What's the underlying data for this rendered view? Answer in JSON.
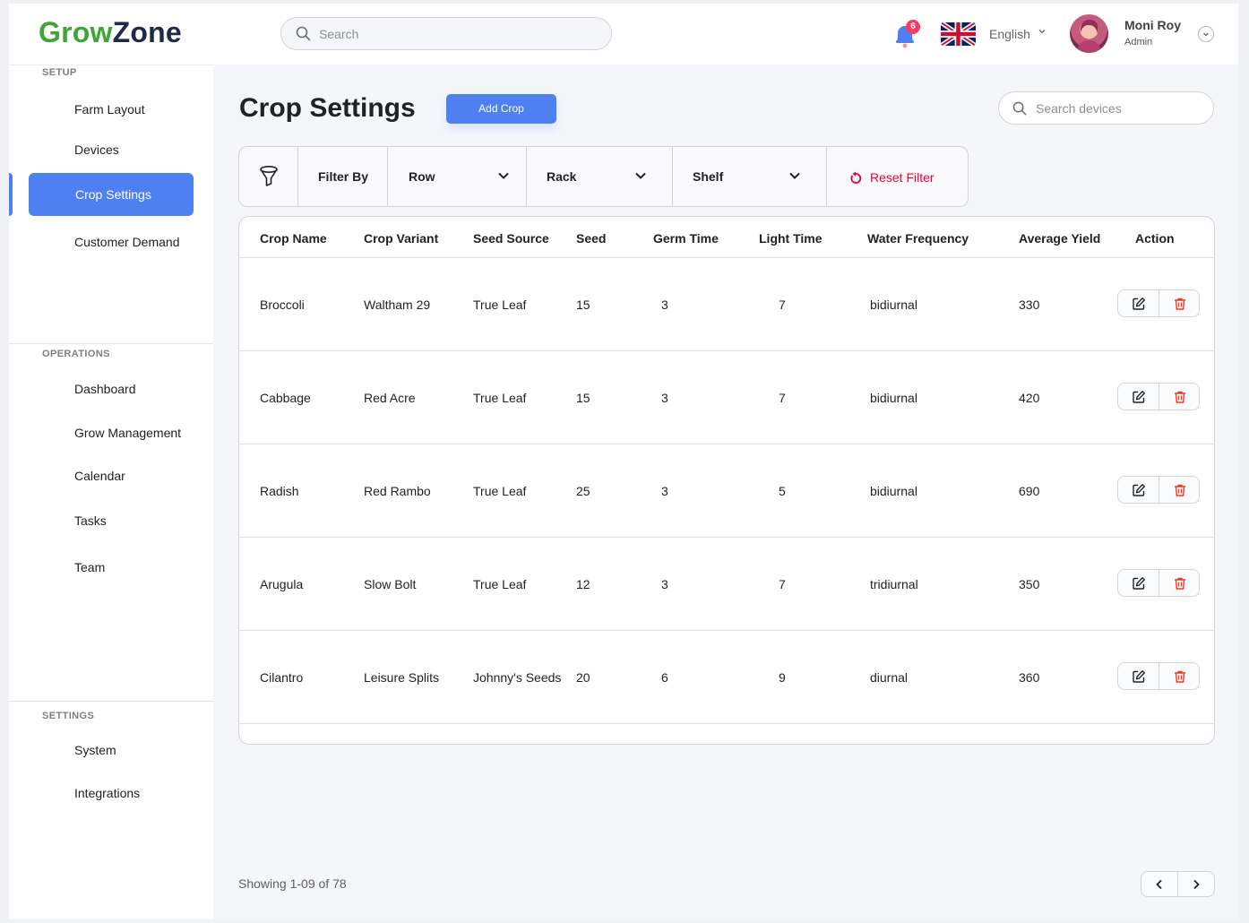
{
  "app": {
    "logo_part1": "Grow",
    "logo_part2": "Zone",
    "search_placeholder": "Search",
    "notification_count": "6",
    "language": "English",
    "user_name": "Moni Roy",
    "user_role": "Admin"
  },
  "sidebar": {
    "setup_heading": "SETUP",
    "setup_items": [
      "Farm Layout",
      "Devices",
      "Crop Settings",
      "Customer Demand"
    ],
    "active_item": "Crop Settings",
    "operations_heading": "OPERATIONS",
    "operations_items": [
      "Dashboard",
      "Grow Management",
      "Calendar",
      "Tasks",
      "Team"
    ],
    "settings_heading": "SETTINGS",
    "settings_items": [
      "System",
      "Integrations"
    ]
  },
  "page": {
    "title": "Crop Settings",
    "add_button": "Add Crop",
    "device_search_placeholder": "Search devices"
  },
  "filter": {
    "label": "Filter By",
    "row": "Row",
    "rack": "Rack",
    "shelf": "Shelf",
    "reset": "Reset Filter"
  },
  "table": {
    "columns": [
      "Crop Name",
      "Crop Variant",
      "Seed Source",
      "Seed",
      "Germ Time",
      "Light Time",
      "Water Frequency",
      "Average Yield",
      "Action"
    ],
    "rows": [
      {
        "name": "Broccoli",
        "variant": "Waltham 29",
        "source": "True Leaf",
        "seed": "15",
        "germ": "3",
        "light": "7",
        "water": "bidiurnal",
        "yield": "330"
      },
      {
        "name": "Cabbage",
        "variant": "Red Acre",
        "source": "True Leaf",
        "seed": "15",
        "germ": "3",
        "light": "7",
        "water": "bidiurnal",
        "yield": "420"
      },
      {
        "name": "Radish",
        "variant": "Red Rambo",
        "source": "True Leaf",
        "seed": "25",
        "germ": "3",
        "light": "5",
        "water": "bidiurnal",
        "yield": "690"
      },
      {
        "name": "Arugula",
        "variant": "Slow Bolt",
        "source": "True Leaf",
        "seed": "12",
        "germ": "3",
        "light": "7",
        "water": "tridiurnal",
        "yield": "350"
      },
      {
        "name": "Cilantro",
        "variant": "Leisure Splits",
        "source": "Johnny's Seeds",
        "seed": "20",
        "germ": "6",
        "light": "9",
        "water": "diurnal",
        "yield": "360"
      }
    ]
  },
  "footer": {
    "showing": "Showing 1-09 of 78"
  },
  "colors": {
    "accent": "#4e80f2",
    "logo_green": "#3fa535",
    "logo_dark": "#1f2a44",
    "danger": "#ea0234"
  },
  "icons": [
    "search-icon",
    "bell-icon",
    "uk-flag-icon",
    "chevron-down-icon",
    "funnel-icon",
    "reset-icon",
    "edit-icon",
    "trash-icon",
    "chevron-left-icon",
    "chevron-right-icon"
  ]
}
